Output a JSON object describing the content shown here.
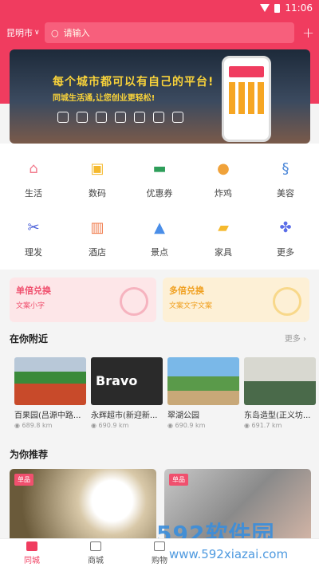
{
  "status": {
    "time": "11:06"
  },
  "header": {
    "city": "昆明市",
    "search_placeholder": "请输入"
  },
  "banner": {
    "line1": "每个城市都可以有自己的平台!",
    "line2": "同城生活通,让您创业更轻松!"
  },
  "categories": [
    {
      "label": "生活",
      "color": "#f27c8e",
      "icon": "home-icon"
    },
    {
      "label": "数码",
      "color": "#f5b92d",
      "icon": "camera-icon"
    },
    {
      "label": "优惠券",
      "color": "#2e9e5a",
      "icon": "coupon-icon"
    },
    {
      "label": "炸鸡",
      "color": "#f0a23a",
      "icon": "drumstick-icon"
    },
    {
      "label": "美容",
      "color": "#4a86d8",
      "icon": "hair-icon"
    },
    {
      "label": "理发",
      "color": "#4a5fd8",
      "icon": "scissors-icon"
    },
    {
      "label": "酒店",
      "color": "#f07a4a",
      "icon": "building-icon"
    },
    {
      "label": "景点",
      "color": "#4a8ee8",
      "icon": "mountain-icon"
    },
    {
      "label": "家具",
      "color": "#f5b92d",
      "icon": "sofa-icon"
    },
    {
      "label": "更多",
      "color": "#5a6de8",
      "icon": "grid-icon"
    }
  ],
  "promos": [
    {
      "title": "单倍兑换",
      "subtitle": "文案小字",
      "bg": "#fde6e8",
      "fg": "#f0506e"
    },
    {
      "title": "多倍兑换",
      "subtitle": "文案文字文案",
      "bg": "#fdf0d6",
      "fg": "#f0a020"
    }
  ],
  "nearby": {
    "title": "在你附近",
    "more": "更多",
    "items": [
      {
        "name": "百果园(吕源中路...",
        "distance": "689.8 km"
      },
      {
        "name": "永辉超市(新迎新...",
        "distance": "690.9 km"
      },
      {
        "name": "翠湖公园",
        "distance": "690.9 km"
      },
      {
        "name": "东岛造型(正义坊...",
        "distance": "691.7 km"
      }
    ]
  },
  "recommend": {
    "title": "为你推荐",
    "tag": "单品"
  },
  "tabs": [
    {
      "label": "同城"
    },
    {
      "label": "商城"
    },
    {
      "label": "购物"
    }
  ],
  "watermark": {
    "brand": "592软件园",
    "url": "www.592xiazai.com"
  }
}
